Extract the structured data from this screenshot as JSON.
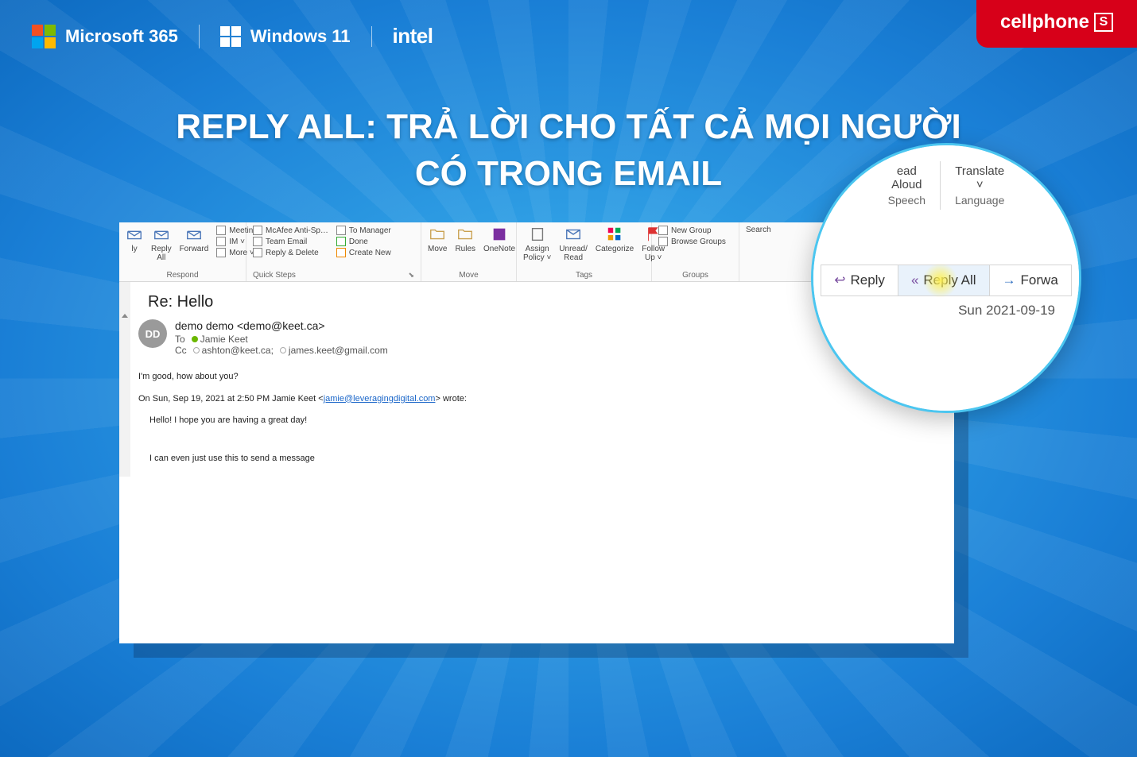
{
  "topbar": {
    "ms365": "Microsoft 365",
    "win": "Windows 11",
    "intel": "intel"
  },
  "brand": {
    "name": "cellphone",
    "icon": "S"
  },
  "headline": {
    "l1": "REPLY ALL: TRẢ LỜI CHO TẤT CẢ MỌI NGƯỜI",
    "l2": "CÓ TRONG EMAIL"
  },
  "ribbon": {
    "respond": {
      "label": "Respond",
      "reply": "ly",
      "replyall": "Reply\nAll",
      "forward": "Forward",
      "meeting": "Meeting",
      "im": "IM ˅",
      "more": "More ˅"
    },
    "quicksteps": {
      "label": "Quick Steps",
      "items": [
        "McAfee Anti-Sp…",
        "Team Email",
        "Reply & Delete",
        "To Manager",
        "Done",
        "Create New"
      ]
    },
    "move": {
      "label": "Move",
      "move": "Move",
      "rules": "Rules",
      "onenote": "OneNote"
    },
    "tags": {
      "label": "Tags",
      "assign": "Assign\nPolicy ˅",
      "unread": "Unread/\nRead",
      "categorize": "Categorize",
      "followup": "Follow\nUp ˅"
    },
    "groups": {
      "label": "Groups",
      "new": "New Group",
      "browse": "Browse Groups"
    },
    "search": {
      "label": "Search"
    }
  },
  "mail": {
    "subject": "Re: Hello",
    "avatar": "DD",
    "from": "demo demo <demo@keet.ca>",
    "to_label": "To",
    "to": "Jamie Keet",
    "cc_label": "Cc",
    "cc1": "ashton@keet.ca;",
    "cc2": "james.keet@gmail.com",
    "body1": "I'm good, how about you?",
    "body2_a": "On Sun, Sep 19, 2021 at 2:50 PM Jamie Keet <",
    "body2_link": "jamie@leveragingdigital.com",
    "body2_b": "> wrote:",
    "quote1": "Hello! I hope you are having a great day!",
    "quote2": "I can even just use this to send a message"
  },
  "lens": {
    "readaloud_top": "ead",
    "readaloud": "Aloud",
    "speech": "Speech",
    "translate": "Translate",
    "translate_drop": "˅",
    "language": "Language",
    "reply": "Reply",
    "replyall": "Reply All",
    "forward": "Forwa",
    "date": "Sun 2021-09-19"
  }
}
